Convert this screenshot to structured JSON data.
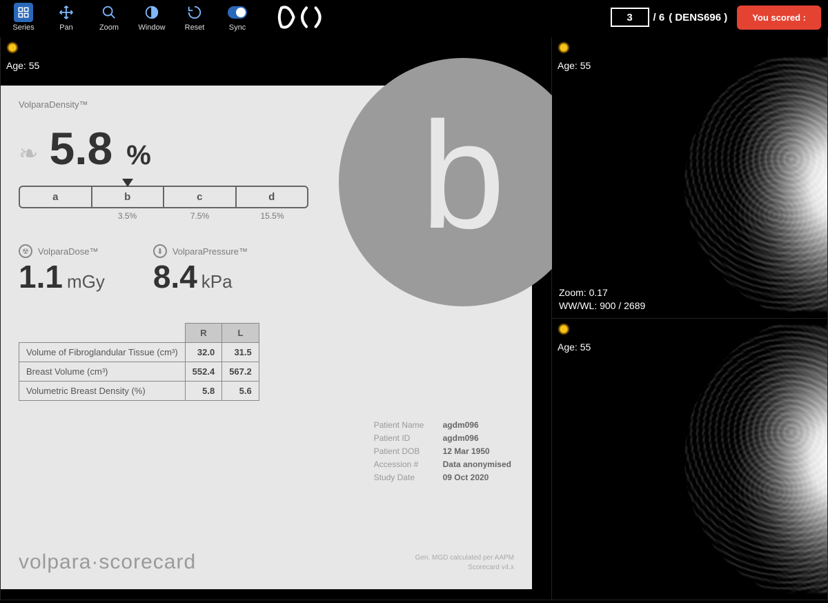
{
  "toolbar": {
    "items": [
      {
        "icon": "grid",
        "label": "Series"
      },
      {
        "icon": "move",
        "label": "Pan"
      },
      {
        "icon": "zoom",
        "label": "Zoom"
      },
      {
        "icon": "window",
        "label": "Window"
      },
      {
        "icon": "reset",
        "label": "Reset"
      },
      {
        "icon": "sync",
        "label": "Sync"
      }
    ],
    "counter": {
      "current": "3",
      "total": "/ 6",
      "case_id": "( DENS696 )"
    },
    "score_button": "You scored :"
  },
  "viewports": {
    "left": {
      "age": "Age: 55"
    },
    "rtop": {
      "age": "Age: 55",
      "zoom": "Zoom: 0.17",
      "wwwl": "WW/WL: 900 / 2689"
    },
    "rbot": {
      "age": "Age: 55"
    }
  },
  "scorecard": {
    "density_label": "VolparaDensity™",
    "density_value": "5.8",
    "density_unit": "%",
    "grade_letter": "b",
    "scale_cells": [
      "a",
      "b",
      "c",
      "d"
    ],
    "scale_ticks": [
      "",
      "3.5%",
      "7.5%",
      "15.5%"
    ],
    "marker_cell": 1,
    "dose_label": "VolparaDose™",
    "dose_value": "1.1",
    "dose_unit": "mGy",
    "pressure_label": "VolparaPressure™",
    "pressure_value": "8.4",
    "pressure_unit": "kPa",
    "table": {
      "cols": [
        "R",
        "L"
      ],
      "rows": [
        {
          "label": "Volume of Fibroglandular Tissue (cm³)",
          "r": "32.0",
          "l": "31.5"
        },
        {
          "label": "Breast Volume (cm³)",
          "r": "552.4",
          "l": "567.2"
        },
        {
          "label": "Volumetric Breast Density (%)",
          "r": "5.8",
          "l": "5.6"
        }
      ]
    },
    "meta": [
      {
        "k": "Patient Name",
        "v": "agdm096"
      },
      {
        "k": "Patient ID",
        "v": "agdm096"
      },
      {
        "k": "Patient DOB",
        "v": "12 Mar 1950"
      },
      {
        "k": "Accession #",
        "v": "Data anonymised"
      },
      {
        "k": "Study Date",
        "v": "09 Oct 2020"
      }
    ],
    "brand": {
      "a": "volpara",
      "b": "scorecard"
    },
    "fineprint1": "Gen. MGD calculated per AAPM",
    "fineprint2": "Scorecard v4.x"
  }
}
